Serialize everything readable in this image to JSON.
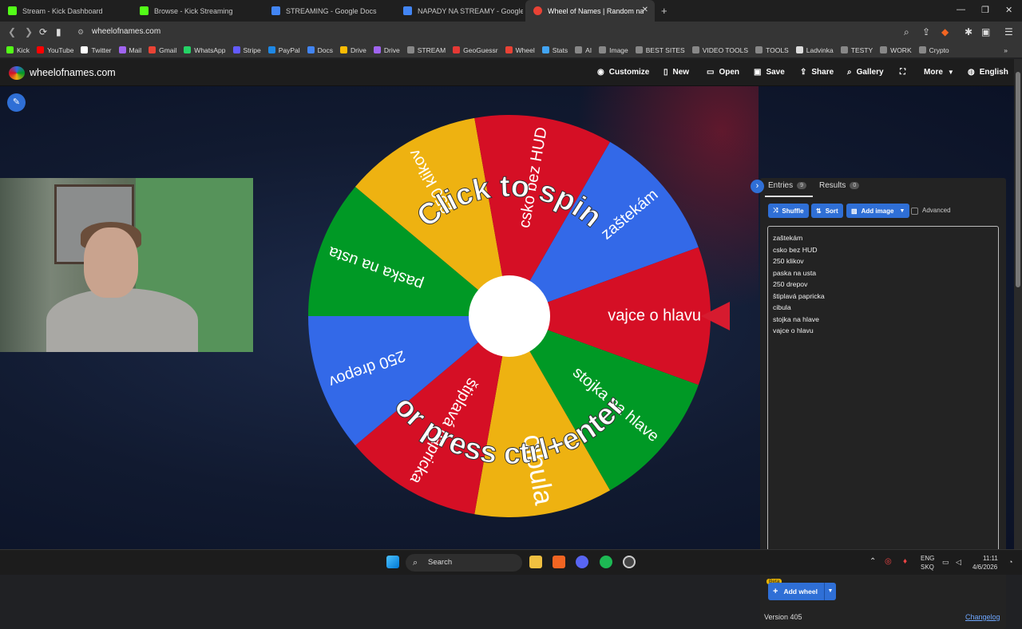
{
  "browser": {
    "tabs": [
      {
        "title": "Stream - Kick Dashboard",
        "fav": "#53fc18"
      },
      {
        "title": "Browse - Kick Streaming",
        "fav": "#53fc18"
      },
      {
        "title": "STREAMING - Google Docs",
        "fav": "#4285f4"
      },
      {
        "title": "NAPADY NA STREAMY - Google Doc",
        "fav": "#4285f4"
      },
      {
        "title": "Wheel of Names | Random name",
        "fav": "#e94235"
      }
    ],
    "new_tab": "+",
    "url": "wheelofnames.com",
    "bookmarks": [
      {
        "label": "Kick",
        "color": "#53fc18"
      },
      {
        "label": "YouTube",
        "color": "#ff0000"
      },
      {
        "label": "Twitter",
        "color": "#ffffff"
      },
      {
        "label": "Mail",
        "color": "#a064f0"
      },
      {
        "label": "Gmail",
        "color": "#ea4335"
      },
      {
        "label": "WhatsApp",
        "color": "#25d366"
      },
      {
        "label": "Stripe",
        "color": "#635bff"
      },
      {
        "label": "PayPal",
        "color": "#1e88e5"
      },
      {
        "label": "Docs",
        "color": "#4285f4"
      },
      {
        "label": "Drive",
        "color": "#fbbc04"
      },
      {
        "label": "Drive",
        "color": "#a064f0"
      },
      {
        "label": "STREAM",
        "color": "#888888"
      },
      {
        "label": "GeoGuessr",
        "color": "#e53935"
      },
      {
        "label": "Wheel",
        "color": "#e94235"
      },
      {
        "label": "Stats",
        "color": "#42a5f5"
      },
      {
        "label": "AI",
        "color": "#888888"
      },
      {
        "label": "Image",
        "color": "#888888"
      },
      {
        "label": "BEST SITES",
        "color": "#888888"
      },
      {
        "label": "VIDEO TOOLS",
        "color": "#888888"
      },
      {
        "label": "TOOLS",
        "color": "#888888"
      },
      {
        "label": "Ladvinka",
        "color": "#dddddd"
      },
      {
        "label": "TESTY",
        "color": "#888888"
      },
      {
        "label": "WORK",
        "color": "#888888"
      },
      {
        "label": "Crypto",
        "color": "#888888"
      }
    ]
  },
  "site": {
    "name": "wheelofnames.com",
    "menu": [
      "Customize",
      "New",
      "Open",
      "Save",
      "Share",
      "Gallery",
      "More",
      "English"
    ]
  },
  "wheel": {
    "segments": [
      {
        "label": "zaštekám",
        "color": "#3369e8"
      },
      {
        "label": "vajce o hlavu",
        "color": "#d50f25"
      },
      {
        "label": "stojka na hlave",
        "color": "#009925"
      },
      {
        "label": "cibula",
        "color": "#eeb211"
      },
      {
        "label": "štiplavá papricka",
        "color": "#d50f25"
      },
      {
        "label": "250 drepov",
        "color": "#3369e8"
      },
      {
        "label": "paska na usta",
        "color": "#009925"
      },
      {
        "label": "250 klikov",
        "color": "#eeb211"
      },
      {
        "label": "csko bez HUD",
        "color": "#d50f25"
      }
    ],
    "spin_text_1": "Click to spin",
    "spin_text_2": "or press ctrl+enter"
  },
  "panel": {
    "entries_label": "Entries",
    "entries_count": "9",
    "results_label": "Results",
    "results_count": "0",
    "shuffle": "Shuffle",
    "sort": "Sort",
    "add_image": "Add image",
    "advanced": "Advanced",
    "entries": [
      "zaštekám",
      "csko bez HUD",
      "250 klikov",
      "paska na usta",
      "250 drepov",
      "štiplavá papricka",
      "cibula",
      "stojka na hlave",
      "vajce o hlavu"
    ],
    "beta": "Beta",
    "add_wheel": "Add wheel",
    "version": "Version 405",
    "changelog": "Changelog"
  },
  "taskbar": {
    "search": "Search",
    "lang_1": "ENG",
    "lang_2": "SKQ",
    "time": "11:11",
    "date": "4/6/2026"
  }
}
